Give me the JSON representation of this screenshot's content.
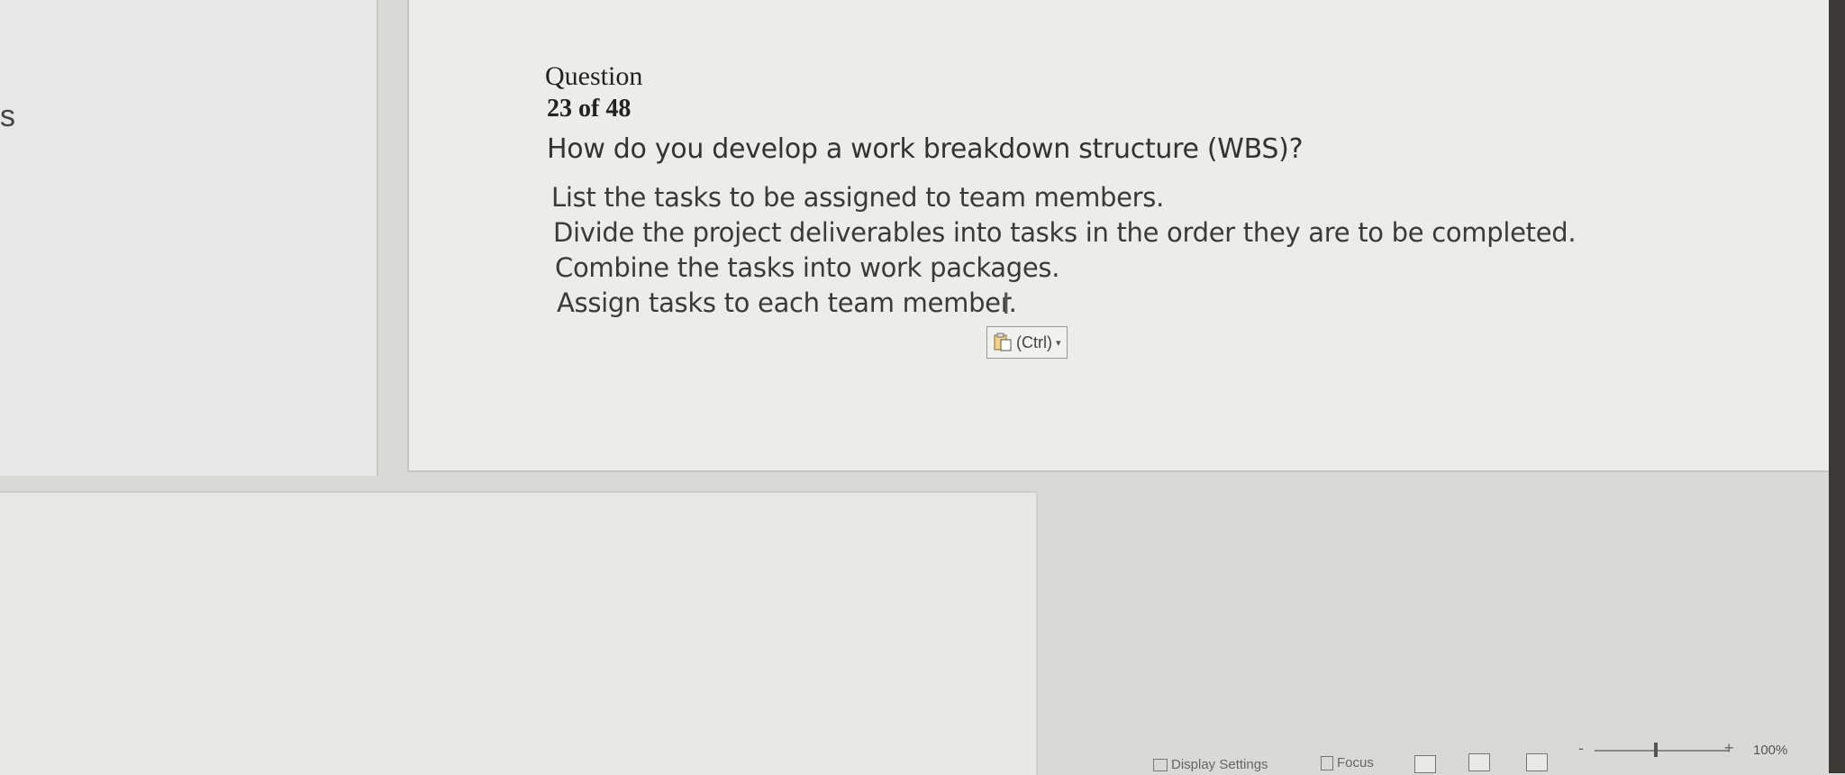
{
  "left_panel": {
    "partial_text": "s"
  },
  "question": {
    "label": "Question",
    "number": "23 of 48",
    "text": "How do you develop a work breakdown structure (WBS)?"
  },
  "answers": [
    "List the tasks to be assigned to team members.",
    "Divide the project deliverables into tasks in the order they are to be completed.",
    "Combine the tasks into work packages.",
    "Assign tasks to each team member."
  ],
  "paste_options": {
    "label": "(Ctrl)",
    "icon": "clipboard-icon"
  },
  "cursor": {
    "glyph": "I"
  },
  "status_bar": {
    "display_settings": "Display Settings",
    "focus": "Focus",
    "zoom_minus": "-",
    "zoom_plus": "+",
    "zoom_level": "100%"
  }
}
